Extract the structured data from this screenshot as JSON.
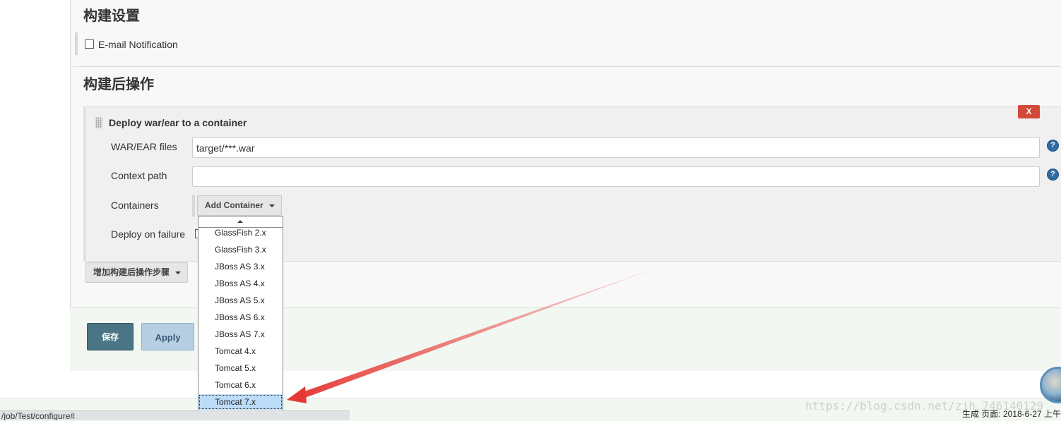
{
  "build_settings": {
    "title": "构建设置",
    "email_notification_label": "E-mail Notification"
  },
  "post_build": {
    "title": "构建后操作",
    "deploy": {
      "title": "Deploy war/ear to a container",
      "close_label": "X",
      "war_ear_label": "WAR/EAR files",
      "war_ear_value": "target/***.war",
      "context_path_label": "Context path",
      "context_path_value": "",
      "containers_label": "Containers",
      "add_container_label": "Add Container",
      "deploy_on_failure_label": "Deploy on failure"
    },
    "add_step_label": "增加构建后操作步骤"
  },
  "container_menu": {
    "items": [
      "GlassFish 2.x",
      "GlassFish 3.x",
      "JBoss AS 3.x",
      "JBoss AS 4.x",
      "JBoss AS 5.x",
      "JBoss AS 6.x",
      "JBoss AS 7.x",
      "Tomcat 4.x",
      "Tomcat 5.x",
      "Tomcat 6.x",
      "Tomcat 7.x"
    ],
    "selected": "Tomcat 7.x"
  },
  "actions": {
    "save_label": "保存",
    "apply_label": "Apply"
  },
  "status_bar": {
    "url": "/job/Test/configure#"
  },
  "footer": {
    "generated": "生成 页面: 2018-6-27 上午"
  },
  "watermark": "https://blog.csdn.net/zjh_746140129",
  "colors": {
    "close_button": "#d24939",
    "save_button": "#4a7584",
    "apply_button": "#b7cfe2",
    "selected_item": "#bcdcf7",
    "annotation_arrow": "#e53935"
  }
}
